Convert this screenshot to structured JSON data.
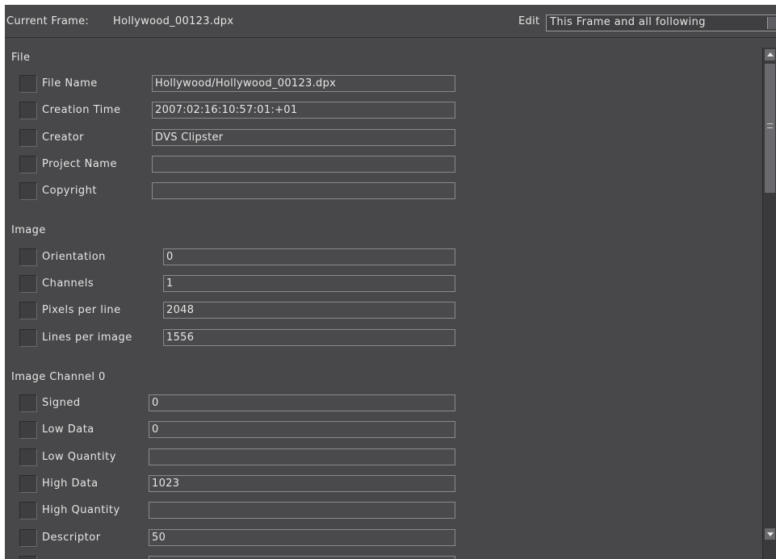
{
  "header": {
    "current_frame_label": "Current Frame:",
    "current_frame_value": "Hollywood_00123.dpx",
    "edit_label": "Edit",
    "edit_value": "This Frame and all following"
  },
  "sections": {
    "file": {
      "title": "File",
      "rows": [
        {
          "label": "File Name",
          "value": "Hollywood/Hollywood_00123.dpx"
        },
        {
          "label": "Creation Time",
          "value": "2007:02:16:10:57:01:+01"
        },
        {
          "label": "Creator",
          "value": "DVS Clipster"
        },
        {
          "label": "Project Name",
          "value": ""
        },
        {
          "label": "Copyright",
          "value": ""
        }
      ]
    },
    "image": {
      "title": "Image",
      "rows": [
        {
          "label": "Orientation",
          "value": "0"
        },
        {
          "label": "Channels",
          "value": "1"
        },
        {
          "label": "Pixels per line",
          "value": "2048"
        },
        {
          "label": "Lines per image",
          "value": "1556"
        }
      ]
    },
    "image_channel_0": {
      "title": "Image Channel 0",
      "rows": [
        {
          "label": "Signed",
          "value": "0"
        },
        {
          "label": "Low Data",
          "value": "0"
        },
        {
          "label": "Low Quantity",
          "value": ""
        },
        {
          "label": "High Data",
          "value": "1023"
        },
        {
          "label": "High Quantity",
          "value": ""
        },
        {
          "label": "Descriptor",
          "value": "50"
        }
      ]
    }
  }
}
